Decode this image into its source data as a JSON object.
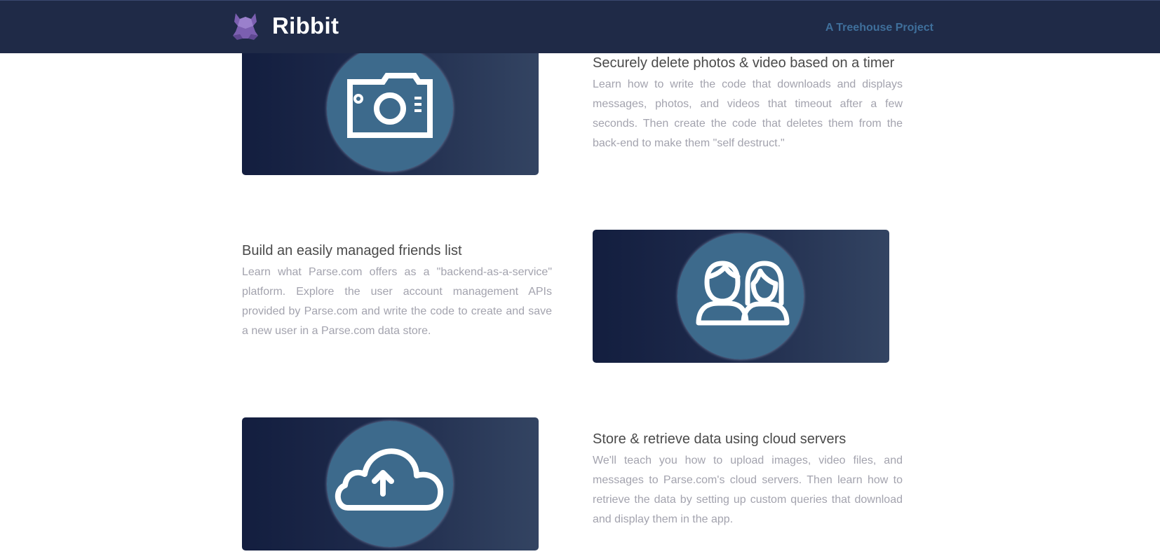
{
  "header": {
    "brand_name": "Ribbit",
    "logo_icon": "frog-icon",
    "project_link": "A Treehouse Project",
    "colors": {
      "background": "#1f2a47",
      "brand_text": "#ffffff",
      "link": "#3f6f9b",
      "logo": "#7b5fb0"
    }
  },
  "features": [
    {
      "title": "Securely delete photos & video based on a timer",
      "body": "Learn how to write the code that downloads and displays messages, photos, and videos that timeout after a few seconds. Then create the code that deletes them from the back-end to make them \"self destruct.\"",
      "icon": "camera-icon"
    },
    {
      "title": "Build an easily managed friends list",
      "body": "Learn what Parse.com offers as a \"backend-as-a-service\" platform. Explore the user account management APIs provided by Parse.com and write the code to create and save a new user in a Parse.com data store.",
      "icon": "friends-icon"
    },
    {
      "title": "Store & retrieve data using cloud servers",
      "body": "We'll teach you how to upload images, video files, and messages to Parse.com's cloud servers. Then learn how to retrieve the data by setting up custom queries that download and display them in the app.",
      "icon": "cloud-upload-icon"
    }
  ],
  "colors": {
    "title_text": "#4a4a4a",
    "body_text": "#a3a3ae",
    "card_gradient_start": "#131e3f",
    "card_gradient_end": "#334462",
    "icon_circle": "#3d6a8c"
  }
}
